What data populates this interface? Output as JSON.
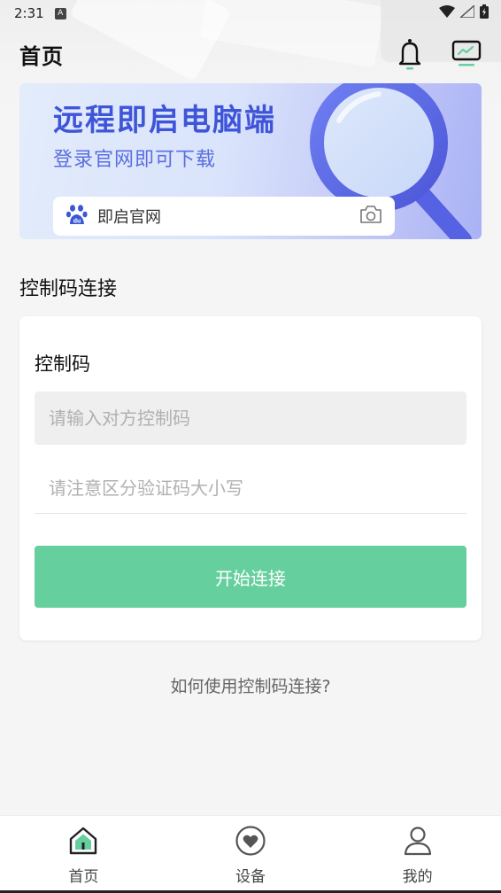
{
  "status_bar": {
    "time": "2:31",
    "notification_badge": "A"
  },
  "header": {
    "title": "首页"
  },
  "banner": {
    "title": "远程即启电脑端",
    "subtitle": "登录官网即可下载",
    "search_text": "即启官网"
  },
  "section": {
    "title": "控制码连接"
  },
  "card": {
    "label": "控制码",
    "input_placeholder": "请输入对方控制码",
    "input_value": "",
    "hint": "请注意区分验证码大小写",
    "connect_label": "开始连接"
  },
  "help_link": "如何使用控制码连接?",
  "bottom_nav": {
    "items": [
      {
        "label": "首页",
        "icon": "home-icon"
      },
      {
        "label": "设备",
        "icon": "heart-icon"
      },
      {
        "label": "我的",
        "icon": "user-icon"
      }
    ]
  },
  "colors": {
    "accent": "#66cf9e",
    "banner_title": "#3f55d9",
    "background": "#f5f5f5"
  }
}
